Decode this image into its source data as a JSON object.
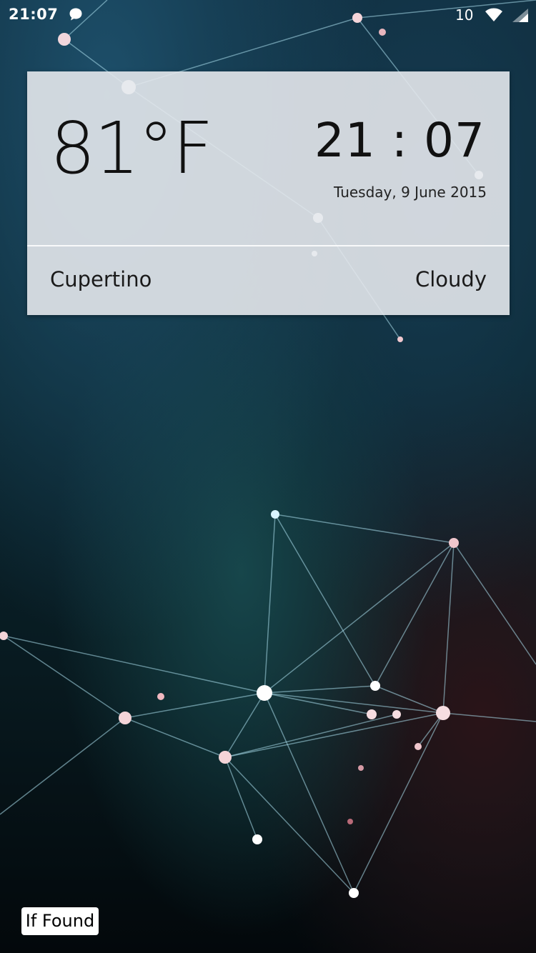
{
  "status_bar": {
    "time": "21:07",
    "notification_icon": "chat-bubble-icon",
    "level": "10",
    "wifi_icon": "wifi-icon",
    "signal_icon": "cell-signal-icon"
  },
  "widget": {
    "temperature": "81°F",
    "time": "21 : 07",
    "date": "Tuesday, 9 June 2015",
    "location": "Cupertino",
    "condition": "Cloudy"
  },
  "if_found": {
    "label": "If Found"
  },
  "colors": {
    "widget_background": "#e4e8ec",
    "wallpaper_dark": "#081a20",
    "wallpaper_teal": "#17464b",
    "text": "#111111"
  }
}
